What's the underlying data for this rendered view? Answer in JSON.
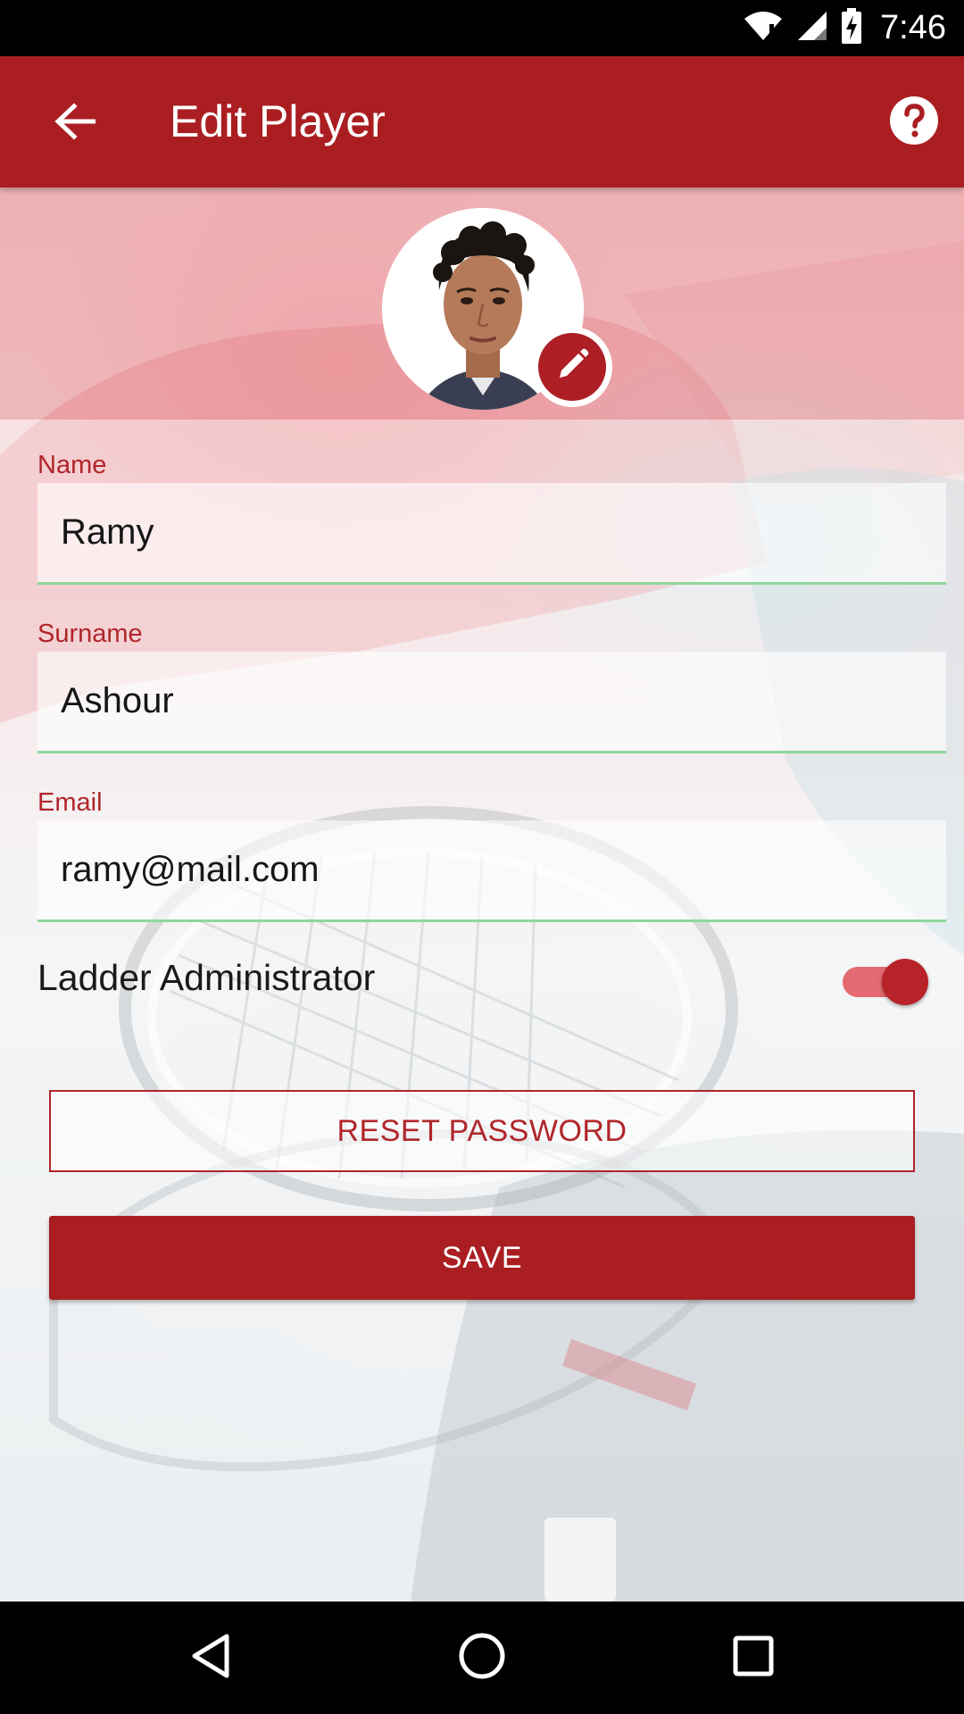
{
  "status_bar": {
    "time": "7:46",
    "icons": [
      "wifi-icon",
      "cell-signal-icon",
      "battery-charging-icon"
    ]
  },
  "toolbar": {
    "title": "Edit Player",
    "back_icon": "arrow-left-icon",
    "help_icon": "help-circle-icon"
  },
  "profile": {
    "edit_icon": "pencil-icon"
  },
  "form": {
    "name": {
      "label": "Name",
      "value": "Ramy"
    },
    "surname": {
      "label": "Surname",
      "value": "Ashour"
    },
    "email": {
      "label": "Email",
      "value": "ramy@mail.com"
    },
    "admin_toggle": {
      "label": "Ladder Administrator",
      "checked": true
    }
  },
  "actions": {
    "reset_password_label": "RESET PASSWORD",
    "save_label": "SAVE"
  },
  "colors": {
    "primary": "#aa1e22",
    "accent_line": "#8fd79a",
    "toggle_track": "#e36a70"
  },
  "nav_bar": {
    "icons": [
      "back-triangle-icon",
      "home-circle-icon",
      "recents-square-icon"
    ]
  }
}
